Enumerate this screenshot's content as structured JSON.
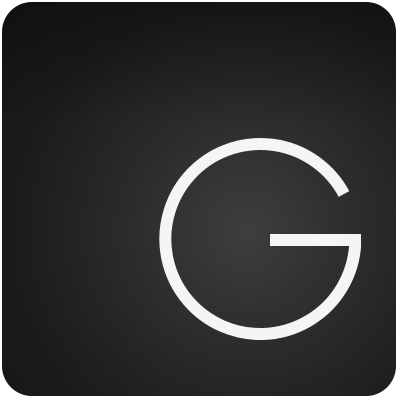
{
  "icon": {
    "letter": "G",
    "colors": {
      "background_dark": "#151516",
      "background_mid": "#2a2a2c",
      "background_light": "#3e3e41",
      "glyph": "#f5f5f5"
    }
  }
}
